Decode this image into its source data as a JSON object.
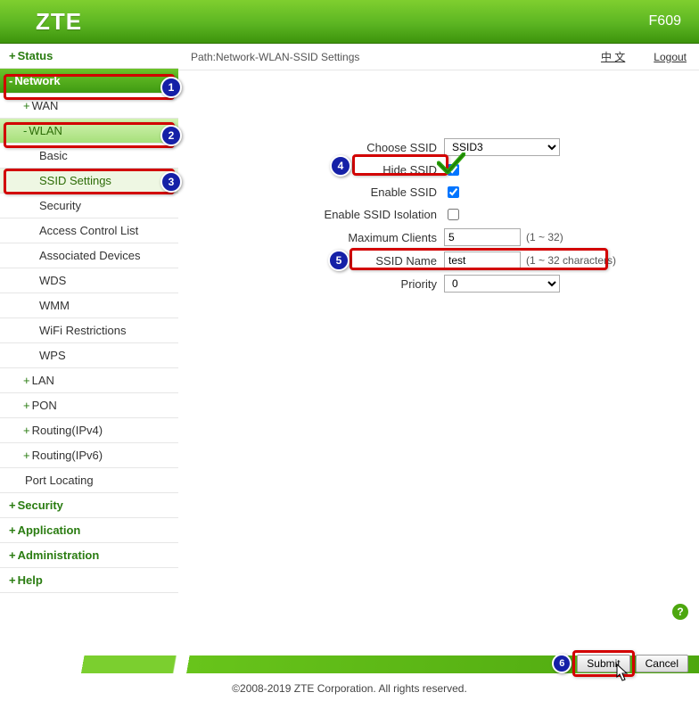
{
  "header": {
    "logo": "ZTE",
    "model": "F609"
  },
  "pathbar": {
    "path": "Path:Network-WLAN-SSID Settings",
    "lang_link": "中 文",
    "logout": "Logout"
  },
  "sidebar": {
    "items": [
      {
        "prefix": "+",
        "label": "Status",
        "level": 0
      },
      {
        "prefix": "-",
        "label": "Network",
        "level": 0,
        "active": "active0"
      },
      {
        "prefix": "+",
        "label": "WAN",
        "level": 1
      },
      {
        "prefix": "-",
        "label": "WLAN",
        "level": 1,
        "active": "active1"
      },
      {
        "prefix": "",
        "label": "Basic",
        "level": 2
      },
      {
        "prefix": "",
        "label": "SSID Settings",
        "level": 2,
        "active": "active2"
      },
      {
        "prefix": "",
        "label": "Security",
        "level": 2
      },
      {
        "prefix": "",
        "label": "Access Control List",
        "level": 2
      },
      {
        "prefix": "",
        "label": "Associated Devices",
        "level": 2
      },
      {
        "prefix": "",
        "label": "WDS",
        "level": 2
      },
      {
        "prefix": "",
        "label": "WMM",
        "level": 2
      },
      {
        "prefix": "",
        "label": "WiFi Restrictions",
        "level": 2
      },
      {
        "prefix": "",
        "label": "WPS",
        "level": 2
      },
      {
        "prefix": "+",
        "label": "LAN",
        "level": 1
      },
      {
        "prefix": "+",
        "label": "PON",
        "level": 1
      },
      {
        "prefix": "+",
        "label": "Routing(IPv4)",
        "level": 1
      },
      {
        "prefix": "+",
        "label": "Routing(IPv6)",
        "level": 1
      },
      {
        "prefix": "",
        "label": "Port Locating",
        "level": 1
      },
      {
        "prefix": "+",
        "label": "Security",
        "level": 0
      },
      {
        "prefix": "+",
        "label": "Application",
        "level": 0
      },
      {
        "prefix": "+",
        "label": "Administration",
        "level": 0
      },
      {
        "prefix": "+",
        "label": "Help",
        "level": 0
      }
    ]
  },
  "form": {
    "choose_ssid_label": "Choose SSID",
    "choose_ssid_value": "SSID3",
    "hide_ssid_label": "Hide SSID",
    "enable_ssid_label": "Enable SSID",
    "enable_isolation_label": "Enable SSID Isolation",
    "max_clients_label": "Maximum Clients",
    "max_clients_value": "5",
    "max_clients_hint": "(1 ~ 32)",
    "ssid_name_label": "SSID Name",
    "ssid_name_value": "test",
    "ssid_name_hint": "(1 ~ 32 characters)",
    "priority_label": "Priority",
    "priority_value": "0"
  },
  "help_tip": "?",
  "buttons": {
    "submit": "Submit",
    "cancel": "Cancel"
  },
  "footer": {
    "copyright": "©2008-2019 ZTE Corporation. All rights reserved."
  }
}
